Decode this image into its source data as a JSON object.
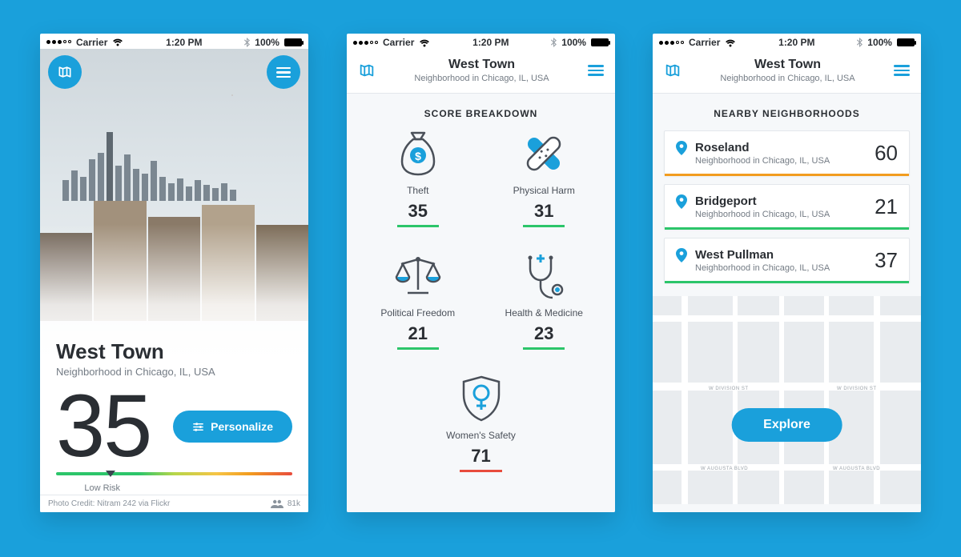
{
  "status": {
    "carrier": "Carrier",
    "time": "1:20 PM",
    "battery": "100%"
  },
  "screen1": {
    "title": "West Town",
    "subtitle": "Neighborhood in Chicago, IL, USA",
    "score": "35",
    "personalize": "Personalize",
    "risk_label": "Low Risk",
    "risk_pct": 23,
    "credit": "Photo Credit: Nitram 242 via Flickr",
    "pop": "81k"
  },
  "screen2": {
    "header_title": "West Town",
    "header_sub": "Neighborhood in Chicago, IL, USA",
    "section": "SCORE BREAKDOWN",
    "metrics": [
      {
        "label": "Theft",
        "value": "35",
        "color": "green"
      },
      {
        "label": "Physical Harm",
        "value": "31",
        "color": "green"
      },
      {
        "label": "Political Freedom",
        "value": "21",
        "color": "green"
      },
      {
        "label": "Health & Medicine",
        "value": "23",
        "color": "green"
      },
      {
        "label": "Women's Safety",
        "value": "71",
        "color": "red"
      }
    ]
  },
  "screen3": {
    "header_title": "West Town",
    "header_sub": "Neighborhood in Chicago, IL, USA",
    "section": "NEARBY NEIGHBORHOODS",
    "items": [
      {
        "name": "Roseland",
        "sub": "Neighborhood in Chicago, IL, USA",
        "score": "60",
        "bar": "orange"
      },
      {
        "name": "Bridgeport",
        "sub": "Neighborhood in Chicago, IL, USA",
        "score": "21",
        "bar": "green"
      },
      {
        "name": "West Pullman",
        "sub": "Neighborhood in Chicago, IL, USA",
        "score": "37",
        "bar": "green"
      }
    ],
    "explore": "Explore",
    "roads": {
      "a": "W DIVISION ST",
      "b": "W AUGUSTA BLVD"
    }
  }
}
